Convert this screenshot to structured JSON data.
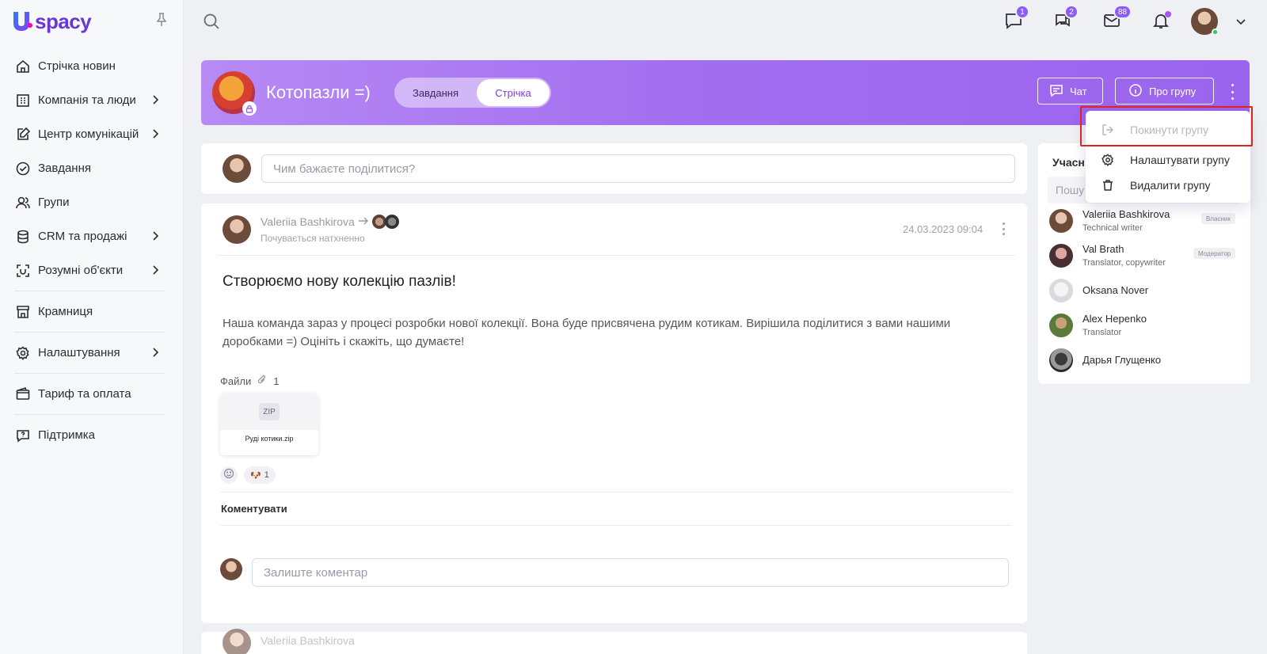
{
  "app": {
    "logo_text": "spacy",
    "logo_letter": "U"
  },
  "sidebar": {
    "items": [
      {
        "label": "Стрічка новин",
        "icon": "home-icon",
        "has_chevron": false
      },
      {
        "label": "Компанія та люди",
        "icon": "building-icon",
        "has_chevron": true
      },
      {
        "label": "Центр комунікацій",
        "icon": "edit-icon",
        "has_chevron": true
      },
      {
        "label": "Завдання",
        "icon": "check-circle-icon",
        "has_chevron": false
      },
      {
        "label": "Групи",
        "icon": "users-icon",
        "has_chevron": false
      },
      {
        "label": "CRM та продажі",
        "icon": "database-icon",
        "has_chevron": true
      },
      {
        "label": "Розумні об'єкти",
        "icon": "smart-object-icon",
        "has_chevron": true
      },
      {
        "label": "Крамниця",
        "icon": "store-icon",
        "has_chevron": false
      },
      {
        "label": "Налаштування",
        "icon": "gear-icon",
        "has_chevron": true
      },
      {
        "label": "Тариф та оплата",
        "icon": "wallet-icon",
        "has_chevron": false
      },
      {
        "label": "Підтримка",
        "icon": "help-icon",
        "has_chevron": false
      }
    ]
  },
  "topbar": {
    "badges": {
      "messages": "1",
      "chats": "2",
      "mail": "88"
    }
  },
  "group": {
    "title": "Котопазли =)",
    "tabs": [
      {
        "label": "Завдання"
      },
      {
        "label": "Стрічка",
        "active": true
      }
    ],
    "chat_button": "Чат",
    "about_button": "Про групу"
  },
  "dropdown": {
    "leave": "Покинути групу",
    "configure": "Налаштувати групу",
    "delete": "Видалити групу"
  },
  "composer": {
    "placeholder": "Чим бажаєте поділитися?"
  },
  "post": {
    "author": "Valeriia Bashkirova",
    "feeling": "Почувається натхненно",
    "date": "24.03.2023 09:04",
    "title": "Створюємо нову колекцію пазлів!",
    "body": "Наша команда зараз у процесі розробки нової колекції. Вона буде присвячена рудим котикам. Вирішила поділитися з вами нашими доробками =) Оцініть і скажіть, що думаєте!",
    "files_label": "Файли",
    "files_count": "1",
    "file_type": "ZIP",
    "file_name": "Руді котики.zip",
    "reaction_count": "1",
    "comment_label": "Коментувати",
    "comment_placeholder": "Залиште коментар"
  },
  "post2": {
    "author": "Valeriia Bashkirova"
  },
  "members": {
    "title": "Учасн",
    "search_placeholder": "Пошу",
    "list": [
      {
        "name": "Valeriia Bashkirova",
        "role": "Technical writer",
        "tag": "Власник"
      },
      {
        "name": "Val Brath",
        "role": "Translator, copywriter",
        "tag": "Модератор"
      },
      {
        "name": "Oksana Nover",
        "role": "",
        "tag": ""
      },
      {
        "name": "Alex Hepenko",
        "role": "Translator",
        "tag": ""
      },
      {
        "name": "Дарья Глущенко",
        "role": "",
        "tag": ""
      }
    ]
  },
  "colors": {
    "accent": "#8b5cf6",
    "header_gradient_start": "#b78af4",
    "header_gradient_end": "#9a64ee",
    "highlight": "#e02424"
  }
}
